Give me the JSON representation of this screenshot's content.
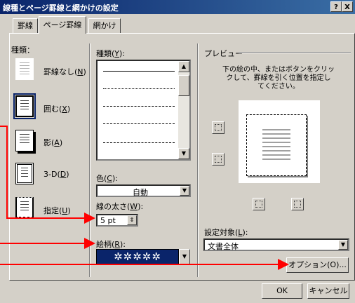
{
  "window": {
    "title": "線種とページ罫線と網かけの設定",
    "help_btn": "?",
    "close_btn": "X"
  },
  "tabs": [
    {
      "label": "罫線"
    },
    {
      "label": "ページ罫線"
    },
    {
      "label": "網かけ"
    }
  ],
  "type_section": {
    "label": "種類：",
    "items": [
      {
        "label": "罫線なし(",
        "key": "N",
        "suffix": ")"
      },
      {
        "label": "囲む(",
        "key": "X",
        "suffix": ")"
      },
      {
        "label": "影(",
        "key": "A",
        "suffix": ")"
      },
      {
        "label": "3-D(",
        "key": "D",
        "suffix": ")"
      },
      {
        "label": "指定(",
        "key": "U",
        "suffix": ")"
      }
    ]
  },
  "style_section": {
    "label": "種類(",
    "key": "Y",
    "suffix": "):",
    "color_label": "色(",
    "color_key": "C",
    "color_suffix": "):",
    "color_value": "自動",
    "width_label": "線の太さ(",
    "width_key": "W",
    "width_suffix": "):",
    "width_value": "5 pt",
    "art_label": "絵柄(",
    "art_key": "R",
    "art_suffix": "):",
    "art_value": "✲✲✲✲✲"
  },
  "preview": {
    "label": "プレビュー",
    "hint": [
      "下の絵の中、またはボタンをクリッ",
      "クして、罫線を引く位置を指定し",
      "てください。"
    ],
    "apply_label": "設定対象(",
    "apply_key": "L",
    "apply_suffix": "):",
    "apply_value": "文書全体",
    "options_button": "オプション(O)..."
  },
  "footer": {
    "ok": "OK",
    "cancel": "キャンセル"
  },
  "colors": {
    "accent": "#0a246a",
    "annotation": "#ff0000",
    "dialog": "#d4d0c8"
  }
}
